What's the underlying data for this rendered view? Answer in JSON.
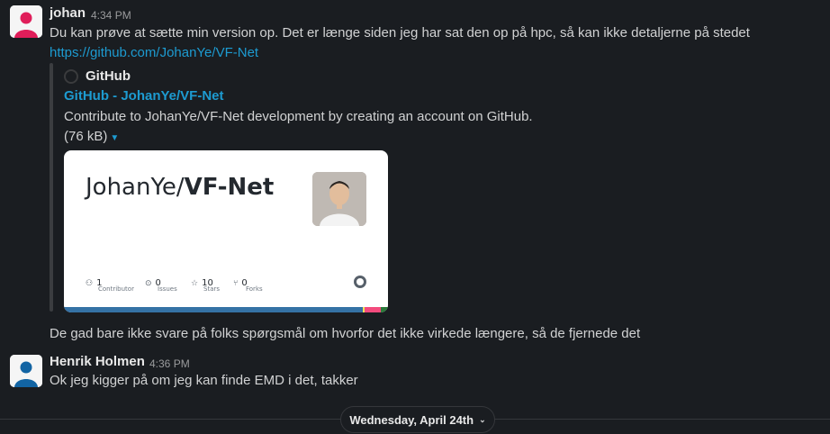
{
  "messages": [
    {
      "user": "johan",
      "time": "4:34 PM",
      "text": "Du kan prøve at sætte min version op. Det er længe siden jeg har sat den op på hpc, så kan ikke detaljerne på stedet",
      "link": "https://github.com/JohanYe/VF-Net",
      "avatar_icon": "person-avatar-pink"
    },
    {
      "text": "De gad bare ikke svare på folks spørgsmål om hvorfor det ikke virkede længere, så de fjernede det"
    },
    {
      "user": "Henrik Holmen",
      "time": "4:36 PM",
      "text": "Ok jeg kigger på om jeg kan finde EMD i det, takker",
      "avatar_icon": "person-avatar-blue"
    }
  ],
  "unfurl": {
    "site_name": "GitHub",
    "title": "GitHub - JohanYe/VF-Net",
    "description": "Contribute to JohanYe/VF-Net development by creating an account on GitHub.",
    "size": "(76 kB)",
    "card": {
      "owner": "JohanYe/",
      "repo": "VF-Net",
      "stats": [
        {
          "icon": "people-icon",
          "value": "1",
          "label": "Contributor"
        },
        {
          "icon": "issue-icon",
          "value": "0",
          "label": "Issues"
        },
        {
          "icon": "star-icon",
          "value": "10",
          "label": "Stars"
        },
        {
          "icon": "fork-icon",
          "value": "0",
          "label": "Forks"
        }
      ],
      "language_colors": [
        "#3572A5",
        "#3572A5",
        "#f1e05a",
        "#e34c26",
        "#f34b7d",
        "#2b7489"
      ]
    }
  },
  "date_divider": "Wednesday, April 24th",
  "colors": {
    "background": "#1a1d21",
    "link": "#1d9bd1",
    "johan_avatar": "#e01e5a",
    "henrik_avatar": "#1264a3"
  }
}
